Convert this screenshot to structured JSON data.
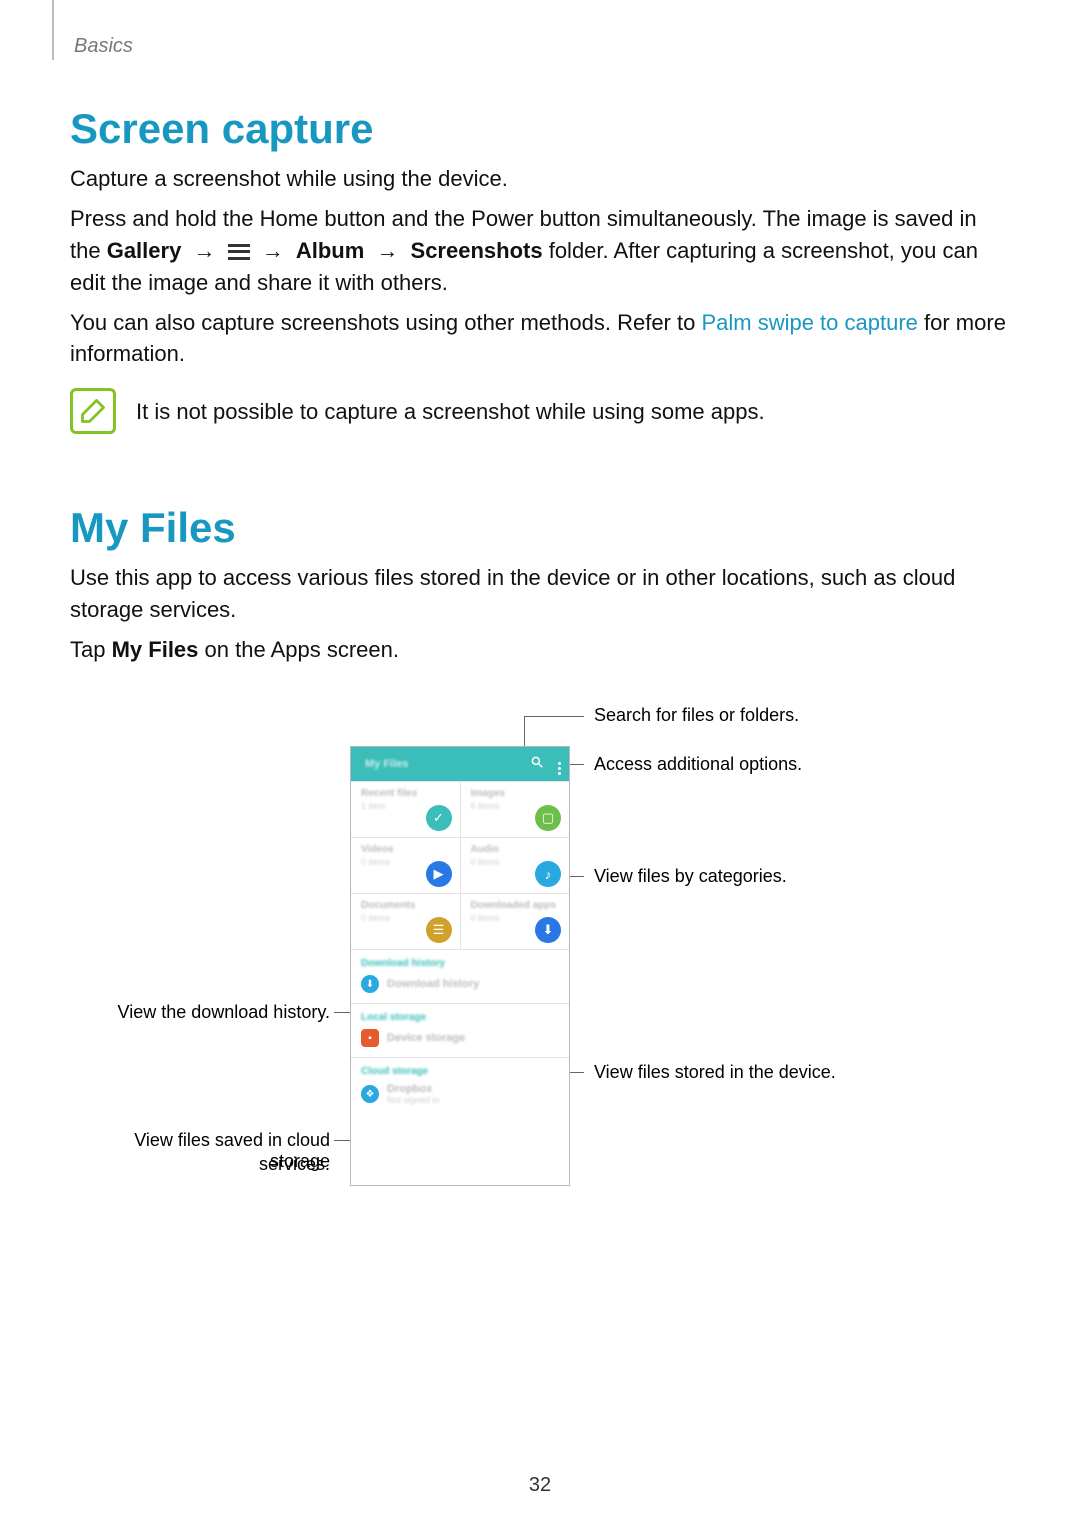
{
  "breadcrumb": "Basics",
  "page_number": "32",
  "screencap": {
    "heading": "Screen capture",
    "p1": "Capture a screenshot while using the device.",
    "p2a": "Press and hold the Home button and the Power button simultaneously. The image is saved in the ",
    "p2_gallery": "Gallery",
    "p2_album": "Album",
    "p2_screenshots": "Screenshots",
    "p2b": " folder. After capturing a screenshot, you can edit the image and share it with others.",
    "p3a": "You can also capture screenshots using other methods. Refer to ",
    "p3_link": "Palm swipe to capture",
    "p3b": " for more information.",
    "note": "It is not possible to capture a screenshot while using some apps."
  },
  "myfiles": {
    "heading": "My Files",
    "p1": "Use this app to access various files stored in the device or in other locations, such as cloud storage services.",
    "p2a": "Tap ",
    "p2_bold": "My Files",
    "p2b": " on the Apps screen."
  },
  "phone": {
    "title": "My Files",
    "search_icon": "search-icon",
    "more_icon": "more-icon",
    "categories": [
      {
        "label": "Recent files",
        "sub": "1 item",
        "icon": "clock",
        "bg": "#3bbeb9"
      },
      {
        "label": "Images",
        "sub": "6 items",
        "icon": "image",
        "bg": "#6cbf4b"
      },
      {
        "label": "Videos",
        "sub": "0 items",
        "icon": "video",
        "bg": "#2a78e4"
      },
      {
        "label": "Audio",
        "sub": "0 items",
        "icon": "music",
        "bg": "#2aa8e0"
      },
      {
        "label": "Documents",
        "sub": "0 items",
        "icon": "doc",
        "bg": "#d0a12d"
      },
      {
        "label": "Downloaded apps",
        "sub": "0 items",
        "icon": "download",
        "bg": "#2a78e4"
      }
    ],
    "download": {
      "header": "Download history",
      "item": "Download history",
      "icon_bg": "#2aa8e0"
    },
    "local": {
      "header": "Local storage",
      "item": "Device storage",
      "icon_bg": "#e55b2e"
    },
    "cloud": {
      "header": "Cloud storage",
      "item": "Dropbox",
      "sub": "Not signed in",
      "icon_bg": "#2aa8e0"
    }
  },
  "callouts": {
    "search": "Search for files or folders.",
    "more": "Access additional options.",
    "categories": "View files by categories.",
    "download": "View the download history.",
    "device": "View files stored in the device.",
    "cloud_a": "View files saved in cloud storage",
    "cloud_b": "services."
  }
}
